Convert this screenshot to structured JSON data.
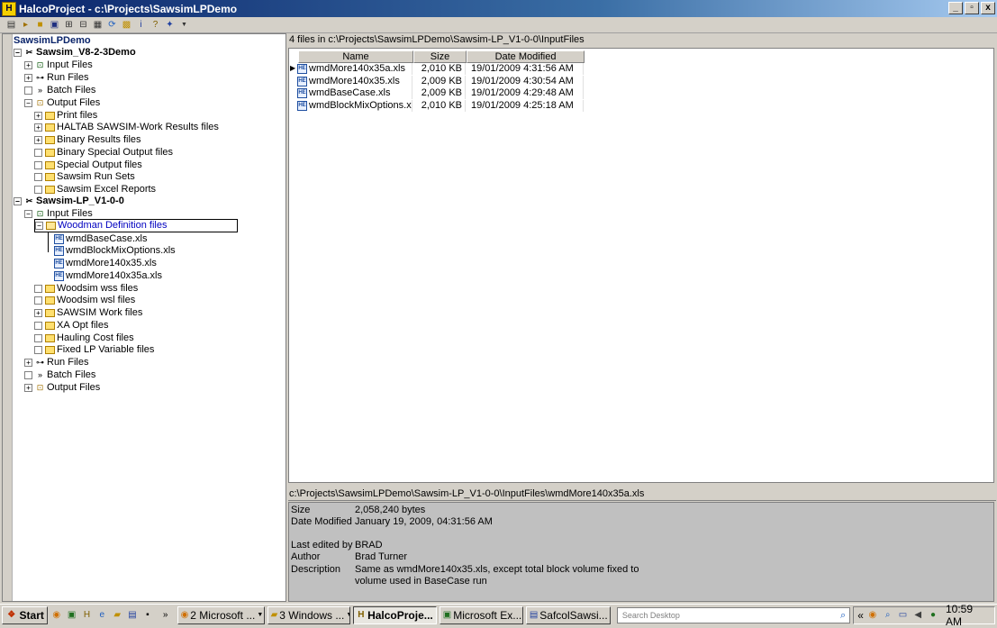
{
  "window": {
    "title": "HalcoProject - c:\\Projects\\SawsimLPDemo",
    "min": "_",
    "restore": "▫",
    "close": "x"
  },
  "toolbar": {
    "icons": [
      "new-icon",
      "open-icon",
      "folder-icon",
      "save-icon",
      "tree-icon",
      "tree-add-icon",
      "properties-icon",
      "refresh-icon",
      "excel-icon",
      "info-icon",
      "help-icon",
      "options-icon"
    ]
  },
  "tree": {
    "root": "SawsimLPDemo",
    "nodes": [
      {
        "label": "Sawsim_V8-2-3Demo"
      },
      {
        "label": "Input Files"
      },
      {
        "label": "Run Files"
      },
      {
        "label": "Batch Files"
      },
      {
        "label": "Output Files"
      },
      {
        "label": "Print files"
      },
      {
        "label": "HALTAB SAWSIM-Work Results files"
      },
      {
        "label": "Binary Results files"
      },
      {
        "label": "Binary Special Output files"
      },
      {
        "label": "Special Output files"
      },
      {
        "label": "Sawsim Run Sets"
      },
      {
        "label": "Sawsim Excel Reports"
      },
      {
        "label": "Sawsim-LP_V1-0-0"
      },
      {
        "label": "Input Files"
      },
      {
        "label": "Woodman Definition files"
      },
      {
        "label": "wmdBaseCase.xls"
      },
      {
        "label": "wmdBlockMixOptions.xls"
      },
      {
        "label": "wmdMore140x35.xls"
      },
      {
        "label": "wmdMore140x35a.xls"
      },
      {
        "label": "Woodsim wss files"
      },
      {
        "label": "Woodsim wsl files"
      },
      {
        "label": "SAWSIM Work files"
      },
      {
        "label": "XA Opt files"
      },
      {
        "label": "Hauling Cost files"
      },
      {
        "label": "Fixed LP Variable files"
      },
      {
        "label": "Run Files"
      },
      {
        "label": "Batch Files"
      },
      {
        "label": "Output Files"
      }
    ]
  },
  "list": {
    "header": "4 files in c:\\Projects\\SawsimLPDemo\\Sawsim-LP_V1-0-0\\InputFiles",
    "columns": [
      "Name",
      "Size",
      "Date Modified"
    ],
    "rows": [
      {
        "name": "wmdMore140x35a.xls",
        "size": "2,010 KB",
        "date": "19/01/2009 4:31:56 AM"
      },
      {
        "name": "wmdMore140x35.xls",
        "size": "2,009 KB",
        "date": "19/01/2009 4:30:54 AM"
      },
      {
        "name": "wmdBaseCase.xls",
        "size": "2,009 KB",
        "date": "19/01/2009 4:29:48 AM"
      },
      {
        "name": "wmdBlockMixOptions.xls",
        "size": "2,010 KB",
        "date": "19/01/2009 4:25:18 AM"
      }
    ]
  },
  "details": {
    "path": "c:\\Projects\\SawsimLPDemo\\Sawsim-LP_V1-0-0\\InputFiles\\wmdMore140x35a.xls",
    "size_label": "Size",
    "size_value": "2,058,240 bytes",
    "date_label": "Date Modified",
    "date_value": "January 19, 2009, 04:31:56 AM",
    "edited_label": "Last edited by",
    "edited_value": "BRAD",
    "author_label": "Author",
    "author_value": "Brad Turner",
    "desc_label": "Description",
    "desc_value_1": "Same as wmdMore140x35.xls, except total block volume fixed to",
    "desc_value_2": "volume used in BaseCase run"
  },
  "taskbar": {
    "start": "Start",
    "more": "»",
    "buttons": [
      "2 Microsoft ...",
      "3 Windows ...",
      "HalcoProje...",
      "Microsoft Ex...",
      "SafcolSawsi..."
    ],
    "search_placeholder": "Search Desktop",
    "tray_more": "«",
    "clock": "10:59 AM"
  }
}
